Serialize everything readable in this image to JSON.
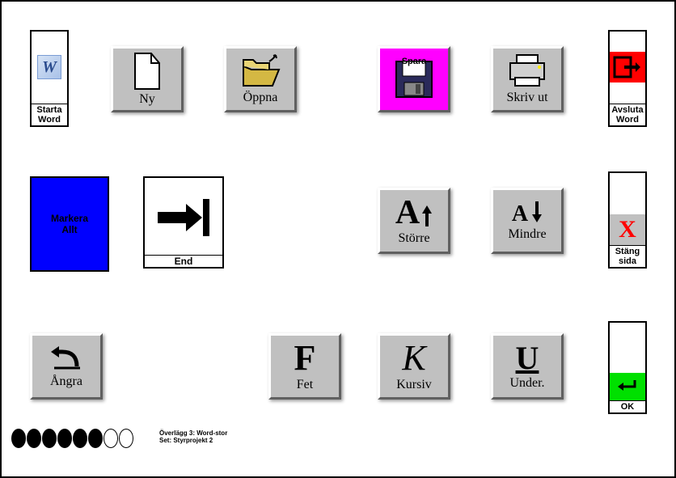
{
  "side": {
    "start": {
      "line1": "Starta",
      "line2": "Word"
    },
    "exit": {
      "line1": "Avsluta",
      "line2": "Word"
    },
    "close": {
      "line1": "Stäng",
      "line2": "sida"
    },
    "ok": {
      "label": "OK"
    }
  },
  "row1": {
    "new": "Ny",
    "open": "Öppna",
    "save": "Spara",
    "print": "Skriv ut"
  },
  "row2": {
    "selectAll": {
      "line1": "Markera",
      "line2": "Allt"
    },
    "end": "End",
    "bigger": "Större",
    "smaller": "Mindre"
  },
  "row3": {
    "undo": "Ångra",
    "bold": "Fet",
    "italic": "Kursiv",
    "underline": "Under."
  },
  "footer": {
    "line1": "Överlägg 3: Word-stor",
    "line2": "Set: Styrprojekt 2"
  },
  "glyphs": {
    "boldF": "F",
    "italicK": "K",
    "underlineU": "U",
    "bigA": "A",
    "smallA": "A",
    "closeX": "X"
  }
}
